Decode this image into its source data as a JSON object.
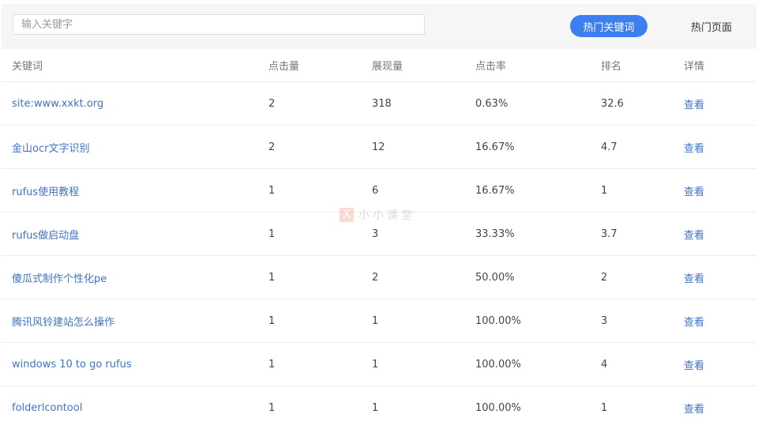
{
  "search": {
    "placeholder": "输入关键字",
    "value": ""
  },
  "tabs": [
    {
      "label": "热门关键词",
      "active": true
    },
    {
      "label": "热门页面",
      "active": false
    }
  ],
  "colors": {
    "accent": "#3d7ff0",
    "link": "#3f72c5"
  },
  "table": {
    "headers": [
      "关键词",
      "点击量",
      "展现量",
      "点击率",
      "排名",
      "详情"
    ],
    "rows": [
      {
        "keyword": "site:www.xxkt.org",
        "clicks": "2",
        "impressions": "318",
        "ctr": "0.63%",
        "rank": "32.6",
        "detail": "查看"
      },
      {
        "keyword": "金山ocr文字识别",
        "clicks": "2",
        "impressions": "12",
        "ctr": "16.67%",
        "rank": "4.7",
        "detail": "查看"
      },
      {
        "keyword": "rufus使用教程",
        "clicks": "1",
        "impressions": "6",
        "ctr": "16.67%",
        "rank": "1",
        "detail": "查看"
      },
      {
        "keyword": "rufus做启动盘",
        "clicks": "1",
        "impressions": "3",
        "ctr": "33.33%",
        "rank": "3.7",
        "detail": "查看"
      },
      {
        "keyword": "傻瓜式制作个性化pe",
        "clicks": "1",
        "impressions": "2",
        "ctr": "50.00%",
        "rank": "2",
        "detail": "查看"
      },
      {
        "keyword": "腾讯风铃建站怎么操作",
        "clicks": "1",
        "impressions": "1",
        "ctr": "100.00%",
        "rank": "3",
        "detail": "查看"
      },
      {
        "keyword": "windows 10 to go rufus",
        "clicks": "1",
        "impressions": "1",
        "ctr": "100.00%",
        "rank": "4",
        "detail": "查看"
      },
      {
        "keyword": "folderlcontool",
        "clicks": "1",
        "impressions": "1",
        "ctr": "100.00%",
        "rank": "1",
        "detail": "查看"
      }
    ]
  },
  "watermark": {
    "logo_glyph": "X",
    "text": "小小课堂"
  }
}
